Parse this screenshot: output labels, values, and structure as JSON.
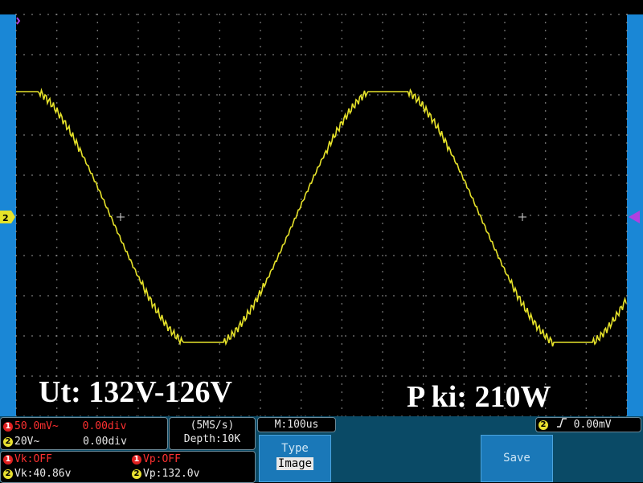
{
  "overlay": {
    "left_text": "Ut: 132V-126V",
    "right_text": "P ki: 210W"
  },
  "channels": {
    "ch1": {
      "badge": "1",
      "scale": "50.0mV~",
      "offset": "0.00div"
    },
    "ch2": {
      "badge": "2",
      "scale": "20V~",
      "offset": "0.00div",
      "marker": "2"
    }
  },
  "acquisition": {
    "sample_rate": "(5MS/s)",
    "depth": "Depth:10K"
  },
  "timebase": "M:100us",
  "trigger": {
    "badge": "2",
    "level": "0.00mV"
  },
  "measurements": {
    "ch1_vk": "Vk:OFF",
    "ch1_vp": "Vp:OFF",
    "ch2_vk": "Vk:40.86v",
    "ch2_vp": "Vp:132.0v"
  },
  "softkeys": {
    "type_label": "Type",
    "type_value": "Image",
    "save_label": "Save"
  },
  "colors": {
    "trace": "#e6e22a",
    "side_bar": "#1a87d6",
    "grid": "#9a9a9a",
    "trigger_marker": "#b040e0"
  }
}
